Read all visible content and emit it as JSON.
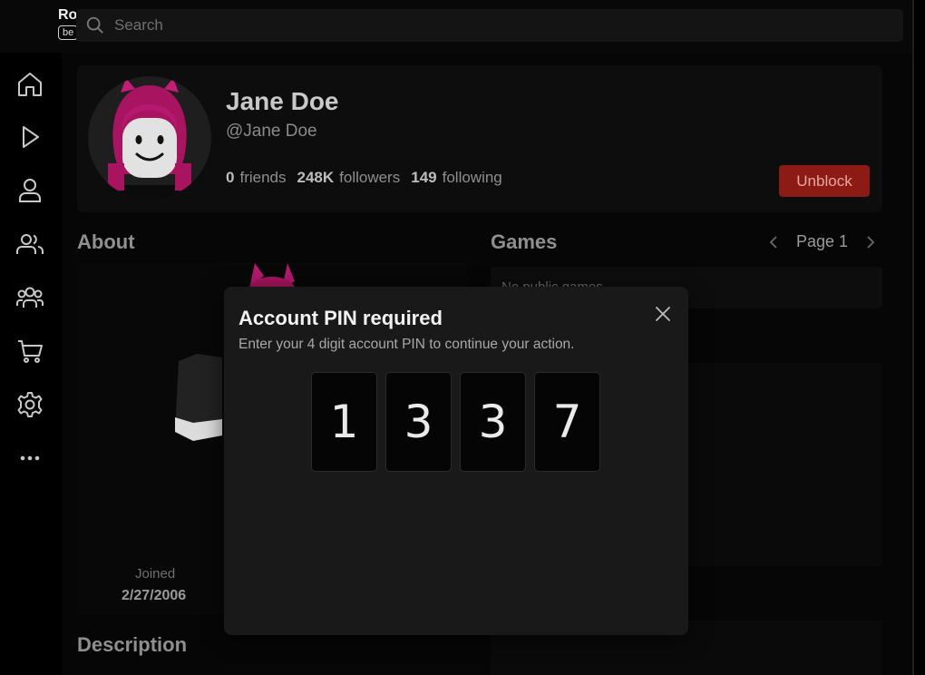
{
  "search": {
    "placeholder": "Search"
  },
  "logo": {
    "text": "Ro",
    "badge": "be"
  },
  "sidebar": {
    "items": [
      {
        "icon": "home-icon"
      },
      {
        "icon": "play-icon"
      },
      {
        "icon": "person-icon"
      },
      {
        "icon": "friends-icon"
      },
      {
        "icon": "groups-icon"
      },
      {
        "icon": "cart-icon"
      },
      {
        "icon": "gear-icon"
      },
      {
        "icon": "more-icon"
      }
    ]
  },
  "profile": {
    "display_name": "Jane Doe",
    "handle": "@Jane Doe",
    "friends_count": "0",
    "friends_label": "friends",
    "followers_count": "248K",
    "followers_label": "followers",
    "following_count": "149",
    "following_label": "following",
    "unblock_label": "Unblock"
  },
  "about": {
    "title": "About",
    "joined_label": "Joined",
    "joined_date": "2/27/2006"
  },
  "games": {
    "title": "Games",
    "page_label": "Page 1",
    "empty_text": "No public games"
  },
  "description": {
    "title": "Description"
  },
  "modal": {
    "title": "Account PIN required",
    "subtitle": "Enter your 4 digit account PIN to continue your action.",
    "pin_digits": [
      "1",
      "3",
      "3",
      "7"
    ]
  },
  "colors": {
    "unblock_bg": "#8c1a15",
    "hair": "#b5196f",
    "modal_bg": "#191919"
  }
}
